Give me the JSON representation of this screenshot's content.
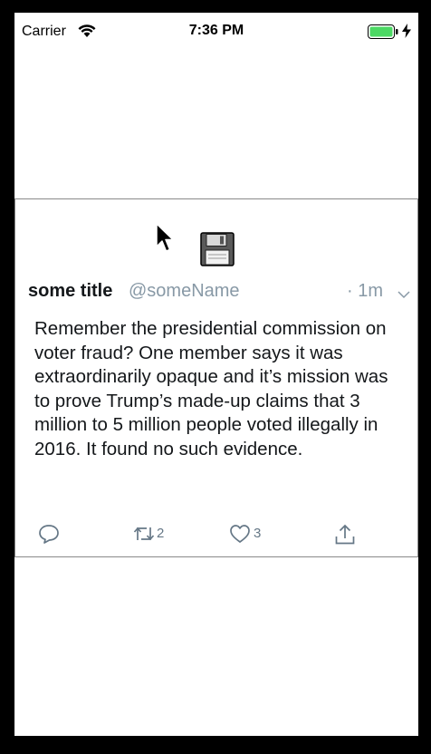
{
  "status_bar": {
    "carrier": "Carrier",
    "time": "7:36 PM"
  },
  "tweet": {
    "name": "some title",
    "handle": "@someName",
    "time_ago": "· 1m",
    "text": "Remember the presidential commission on voter fraud? One member says it was extraordinarily opaque and it’s mission was to prove Trump’s made-up claims that 3 million to 5 million people voted illegally in 2016. It found no such evidence.",
    "actions": {
      "retweet_count": "2",
      "like_count": "3"
    }
  },
  "colors": {
    "accent": "#1da1f2",
    "icon": "#657786",
    "secondary_text": "#8899a6",
    "battery": "#4cd964"
  },
  "icons": [
    "wifi-icon",
    "battery-icon",
    "charging-icon",
    "cursor-icon",
    "save-icon",
    "chevron-down-icon",
    "reply-icon",
    "retweet-icon",
    "like-icon",
    "share-icon"
  ]
}
